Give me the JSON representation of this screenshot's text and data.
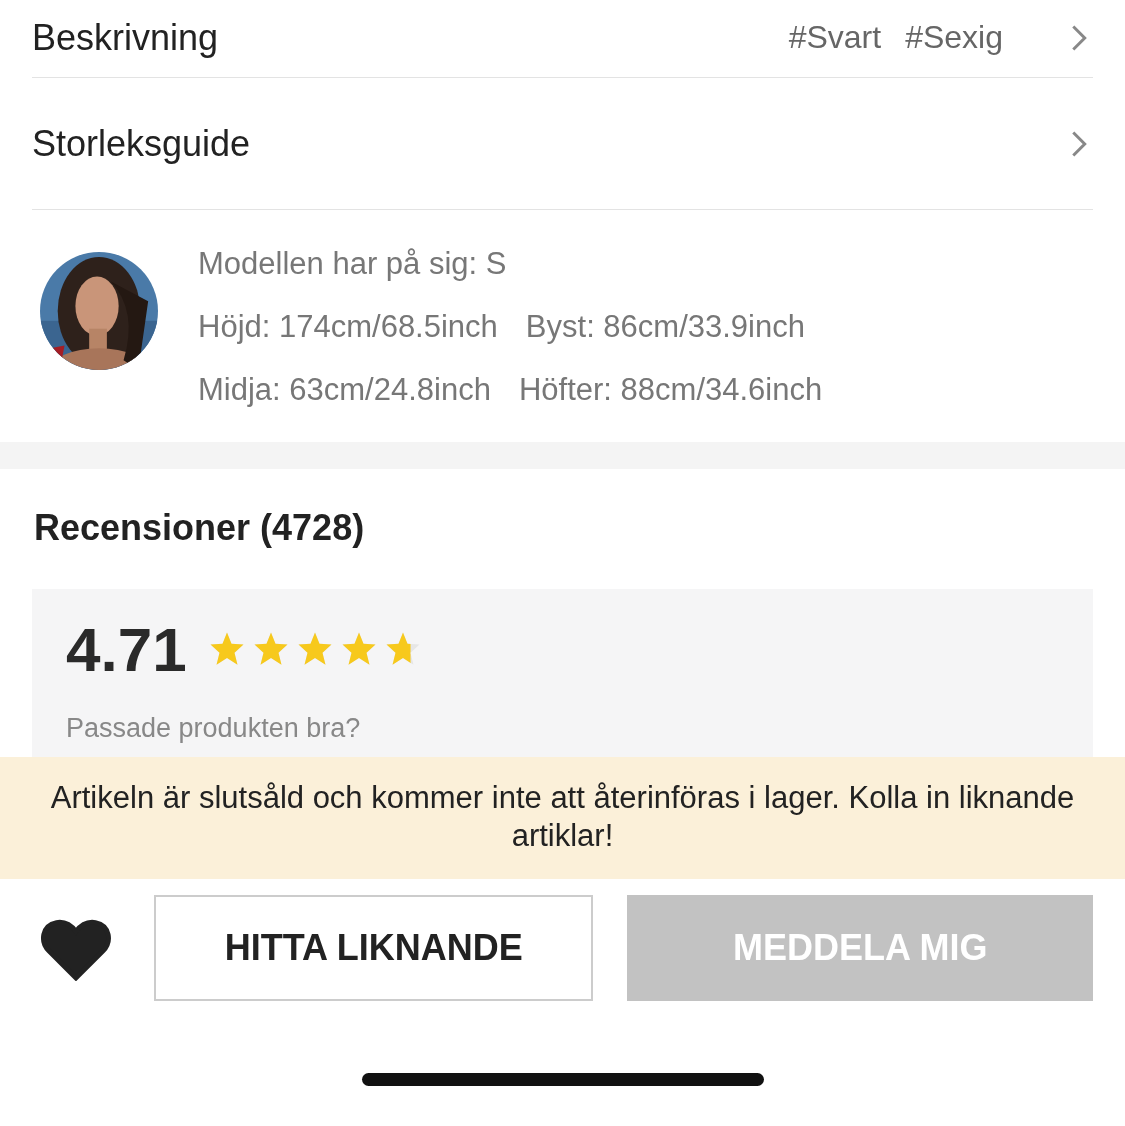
{
  "description_row": {
    "label": "Beskrivning",
    "tags": [
      "#Svart",
      "#Sexig"
    ]
  },
  "size_guide_row": {
    "label": "Storleksguide"
  },
  "model_info": {
    "avatar": {
      "kind": "picture"
    },
    "lines": [
      [
        "Modellen har på sig: S"
      ],
      [
        "Höjd: 174cm/68.5inch",
        "Byst: 86cm/33.9inch"
      ],
      [
        "Midja: 63cm/24.8inch",
        "Höfter: 88cm/34.6inch"
      ]
    ]
  },
  "reviews": {
    "heading": "Recensioner (4728)",
    "score": "4.71",
    "stars": 4.71,
    "question": "Passade produkten bra?"
  },
  "notice": "Artikeln är slutsåld och kommer inte att återinföras i lager. Kolla in liknande artiklar!",
  "actions": {
    "favorite": {
      "selected": true
    },
    "find_similar": "HITTA LIKNANDE",
    "notify": {
      "label": "MEDDELA MIG",
      "disabled": true
    }
  }
}
